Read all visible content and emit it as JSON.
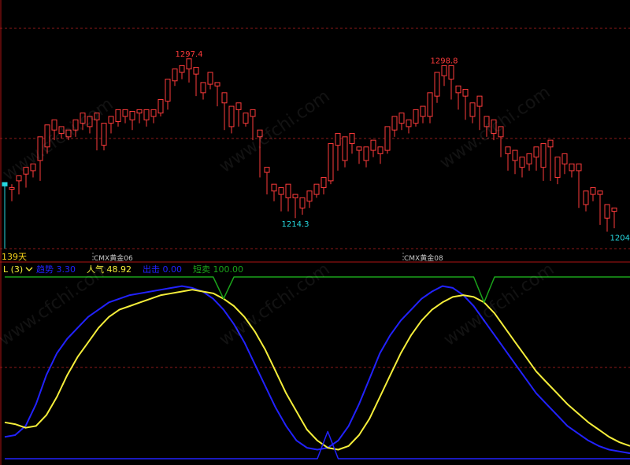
{
  "colors": {
    "background": "#000000",
    "up_candle": "#ff3b3b",
    "down_candle": "#26d9e0",
    "grid": "#8b1a1a",
    "panel_border": "#b01515",
    "trend_line": "#2222ff",
    "popularity_line": "#f5ee3a",
    "short_sell_line": "#1aa31a",
    "label_white": "#c8c8c8",
    "days_label": "#f5d31a"
  },
  "watermark": "www.cfchi.com",
  "chart_data": [
    {
      "type": "candlestick",
      "title": "",
      "period_label": "139天",
      "contract_labels": [
        "CMX黄金06",
        "CMX黄金08"
      ],
      "ylim": [
        1190,
        1320
      ],
      "grid": true,
      "price_labels": {
        "high_1": "1297.4",
        "low_1": "1214.3",
        "high_2": "1298.8",
        "low_2": "1204"
      },
      "candles": [
        [
          1229,
          1227,
          1190,
          1192
        ],
        [
          1225,
          1226,
          1218,
          1228
        ],
        [
          1230,
          1233,
          1222,
          1227
        ],
        [
          1234,
          1238,
          1226,
          1230
        ],
        [
          1236,
          1240,
          1232,
          1238
        ],
        [
          1242,
          1256,
          1230,
          1252
        ],
        [
          1250,
          1263,
          1246,
          1262
        ],
        [
          1260,
          1266,
          1254,
          1258
        ],
        [
          1258,
          1262,
          1255,
          1260
        ],
        [
          1256,
          1260,
          1254,
          1258
        ],
        [
          1260,
          1266,
          1256,
          1264
        ],
        [
          1264,
          1270,
          1260,
          1262
        ],
        [
          1262,
          1268,
          1258,
          1265
        ],
        [
          1266,
          1270,
          1248,
          1250
        ],
        [
          1251,
          1264,
          1248,
          1262
        ],
        [
          1264,
          1268,
          1258,
          1266
        ],
        [
          1265,
          1272,
          1262,
          1268
        ],
        [
          1268,
          1272,
          1264,
          1270
        ],
        [
          1266,
          1271,
          1260,
          1270
        ],
        [
          1270,
          1272,
          1264,
          1265
        ],
        [
          1266,
          1272,
          1262,
          1268
        ],
        [
          1268,
          1272,
          1264,
          1270
        ],
        [
          1270,
          1278,
          1268,
          1276
        ],
        [
          1277,
          1290,
          1272,
          1289
        ],
        [
          1289,
          1296,
          1286,
          1294
        ],
        [
          1294,
          1298,
          1290,
          1295
        ],
        [
          1296,
          1302,
          1288,
          1292
        ],
        [
          1293,
          1297,
          1280,
          1282
        ],
        [
          1282,
          1288,
          1278,
          1286
        ],
        [
          1287,
          1294,
          1284,
          1290
        ],
        [
          1286,
          1288,
          1274,
          1276
        ],
        [
          1276,
          1282,
          1260,
          1262
        ],
        [
          1262,
          1274,
          1258,
          1272
        ],
        [
          1272,
          1276,
          1262,
          1264
        ],
        [
          1264,
          1270,
          1262,
          1268
        ],
        [
          1268,
          1272,
          1254,
          1256
        ],
        [
          1256,
          1260,
          1232,
          1234
        ],
        [
          1235,
          1238,
          1222,
          1224
        ],
        [
          1224,
          1228,
          1218,
          1222
        ],
        [
          1222,
          1226,
          1212,
          1218
        ],
        [
          1220,
          1228,
          1212,
          1224
        ],
        [
          1220,
          1222,
          1208,
          1212
        ],
        [
          1214,
          1220,
          1210,
          1218
        ],
        [
          1218,
          1224,
          1214,
          1222
        ],
        [
          1222,
          1228,
          1220,
          1226
        ],
        [
          1226,
          1232,
          1222,
          1230
        ],
        [
          1230,
          1252,
          1228,
          1250
        ],
        [
          1251,
          1258,
          1236,
          1240
        ],
        [
          1242,
          1256,
          1238,
          1252
        ],
        [
          1252,
          1258,
          1246,
          1250
        ],
        [
          1248,
          1250,
          1240,
          1242
        ],
        [
          1242,
          1250,
          1238,
          1248
        ],
        [
          1248,
          1254,
          1244,
          1246
        ],
        [
          1246,
          1250,
          1240,
          1248
        ],
        [
          1248,
          1262,
          1246,
          1260
        ],
        [
          1260,
          1268,
          1256,
          1264
        ],
        [
          1264,
          1270,
          1260,
          1262
        ],
        [
          1262,
          1266,
          1258,
          1264
        ],
        [
          1264,
          1272,
          1262,
          1270
        ],
        [
          1268,
          1274,
          1264,
          1266
        ],
        [
          1268,
          1282,
          1264,
          1280
        ],
        [
          1280,
          1294,
          1276,
          1292
        ],
        [
          1292,
          1298,
          1286,
          1288
        ],
        [
          1290,
          1298,
          1278,
          1280
        ],
        [
          1282,
          1286,
          1272,
          1284
        ],
        [
          1280,
          1284,
          1266,
          1268
        ],
        [
          1268,
          1276,
          1264,
          1274
        ],
        [
          1274,
          1280,
          1260,
          1262
        ],
        [
          1262,
          1268,
          1256,
          1258
        ],
        [
          1258,
          1266,
          1254,
          1256
        ],
        [
          1256,
          1262,
          1244,
          1246
        ],
        [
          1246,
          1250,
          1236,
          1240
        ],
        [
          1242,
          1248,
          1234,
          1236
        ],
        [
          1238,
          1244,
          1232,
          1242
        ],
        [
          1240,
          1246,
          1236,
          1244
        ],
        [
          1244,
          1250,
          1236,
          1238
        ],
        [
          1238,
          1252,
          1230,
          1250
        ],
        [
          1250,
          1254,
          1230,
          1232
        ],
        [
          1232,
          1244,
          1228,
          1240
        ],
        [
          1240,
          1246,
          1234,
          1236
        ],
        [
          1236,
          1240,
          1232,
          1238
        ],
        [
          1236,
          1240,
          1214,
          1216
        ],
        [
          1216,
          1224,
          1212,
          1222
        ],
        [
          1222,
          1226,
          1218,
          1220
        ],
        [
          1222,
          1224,
          1204,
          1208
        ],
        [
          1208,
          1216,
          1200,
          1214
        ],
        [
          1212,
          1214,
          1202,
          1210
        ]
      ]
    },
    {
      "type": "line",
      "title": "L (3)",
      "legend": [
        {
          "name": "趋势",
          "value": "3.30",
          "color": "#2222ff"
        },
        {
          "name": "人气",
          "value": "48.92",
          "color": "#f5ee3a"
        },
        {
          "name": "出击",
          "value": "0.00",
          "color": "#2222ff"
        },
        {
          "name": "短卖",
          "value": "100.00",
          "color": "#1aa31a"
        }
      ],
      "ylim": [
        0,
        100
      ],
      "grid": true,
      "series": [
        {
          "name": "趋势",
          "values": [
            12,
            13,
            18,
            30,
            46,
            58,
            66,
            72,
            78,
            82,
            86,
            88,
            90,
            91,
            92,
            93,
            94,
            95,
            94,
            92,
            88,
            82,
            74,
            64,
            52,
            40,
            28,
            18,
            10,
            6,
            5,
            6,
            10,
            18,
            30,
            44,
            58,
            68,
            76,
            82,
            88,
            92,
            95,
            94,
            90,
            84,
            76,
            68,
            60,
            52,
            44,
            36,
            30,
            24,
            18,
            14,
            10,
            7,
            5,
            4,
            3
          ]
        },
        {
          "name": "人气",
          "values": [
            20,
            19,
            17,
            18,
            24,
            34,
            46,
            56,
            64,
            72,
            78,
            82,
            84,
            86,
            88,
            90,
            91,
            92,
            93,
            92,
            91,
            88,
            84,
            78,
            70,
            60,
            48,
            36,
            26,
            16,
            10,
            6,
            5,
            7,
            13,
            22,
            34,
            46,
            58,
            68,
            76,
            82,
            86,
            89,
            90,
            89,
            86,
            80,
            72,
            64,
            56,
            48,
            42,
            36,
            30,
            25,
            20,
            16,
            12,
            9,
            7
          ]
        },
        {
          "name": "出击",
          "values": [
            0,
            0,
            0,
            0,
            0,
            0,
            0,
            0,
            0,
            0,
            0,
            0,
            0,
            0,
            0,
            0,
            0,
            0,
            0,
            0,
            0,
            0,
            0,
            0,
            0,
            0,
            0,
            0,
            0,
            0,
            0,
            15,
            0,
            0,
            0,
            0,
            0,
            0,
            0,
            0,
            0,
            0,
            0,
            0,
            0,
            0,
            0,
            0,
            0,
            0,
            0,
            0,
            0,
            0,
            0,
            0,
            0,
            0,
            0,
            0,
            0
          ]
        },
        {
          "name": "短卖",
          "values": [
            100,
            100,
            100,
            100,
            100,
            100,
            100,
            100,
            100,
            100,
            100,
            100,
            100,
            100,
            100,
            100,
            100,
            100,
            100,
            100,
            100,
            88,
            100,
            100,
            100,
            100,
            100,
            100,
            100,
            100,
            100,
            100,
            100,
            100,
            100,
            100,
            100,
            100,
            100,
            100,
            100,
            100,
            100,
            100,
            100,
            100,
            86,
            100,
            100,
            100,
            100,
            100,
            100,
            100,
            100,
            100,
            100,
            100,
            100,
            100,
            100
          ]
        }
      ]
    }
  ]
}
